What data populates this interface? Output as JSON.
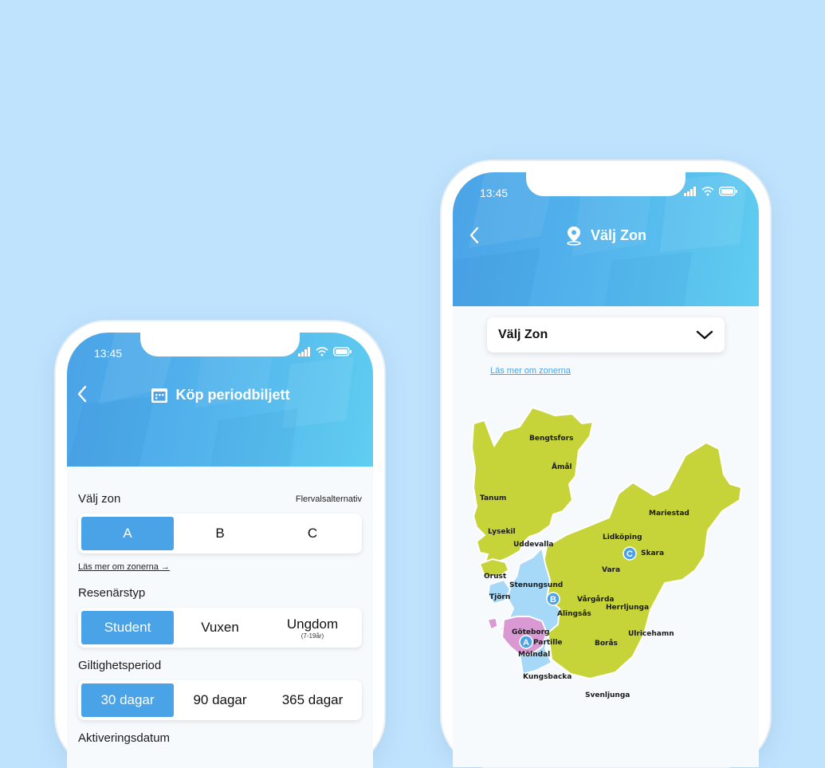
{
  "colors": {
    "background": "#bfe3fd",
    "accent": "#4aa3e6",
    "zone_a": "#d99ad4",
    "zone_b": "#a6d8f7",
    "zone_c": "#c6d43a"
  },
  "left_phone": {
    "status": {
      "time": "13:45"
    },
    "header": {
      "back_icon": "chevron-left-icon",
      "title_icon": "calendar-icon",
      "title": "Köp periodbiljett"
    },
    "zone": {
      "label": "Välj zon",
      "note": "Flervalsalternativ",
      "options": [
        "A",
        "B",
        "C"
      ],
      "selected": "A",
      "read_more": "Läs mer om zonerna →"
    },
    "traveler": {
      "label": "Resenärstyp",
      "options": [
        "Student",
        "Vuxen",
        "Ungdom"
      ],
      "ungdom_sub": "(7-19år)",
      "selected": "Student"
    },
    "validity": {
      "label": "Giltighetsperiod",
      "options": [
        "30 dagar",
        "90 dagar",
        "365 dagar"
      ],
      "selected": "30 dagar"
    },
    "activation": {
      "label": "Aktiveringsdatum"
    }
  },
  "right_phone": {
    "status": {
      "time": "13:45"
    },
    "header": {
      "back_icon": "chevron-left-icon",
      "title_icon": "location-pin-icon",
      "title": "Välj Zon"
    },
    "dropdown": {
      "value": "Välj Zon",
      "icon": "chevron-down-icon"
    },
    "read_more": "Läs mer om zonerna",
    "map": {
      "zone_markers": [
        "A",
        "B",
        "C"
      ],
      "places": [
        "Bengtsfors",
        "Åmål",
        "Tanum",
        "Mariestad",
        "Lysekil",
        "Uddevalla",
        "Lidköping",
        "Skara",
        "Vara",
        "Orust",
        "Stenungsund",
        "Tjörn",
        "Vårgårda",
        "Alingsås",
        "Herrljunga",
        "Göteborg",
        "Partille",
        "Mölndal",
        "Borås",
        "Ulricehamn",
        "Kungsbacka",
        "Svenljunga"
      ]
    }
  }
}
